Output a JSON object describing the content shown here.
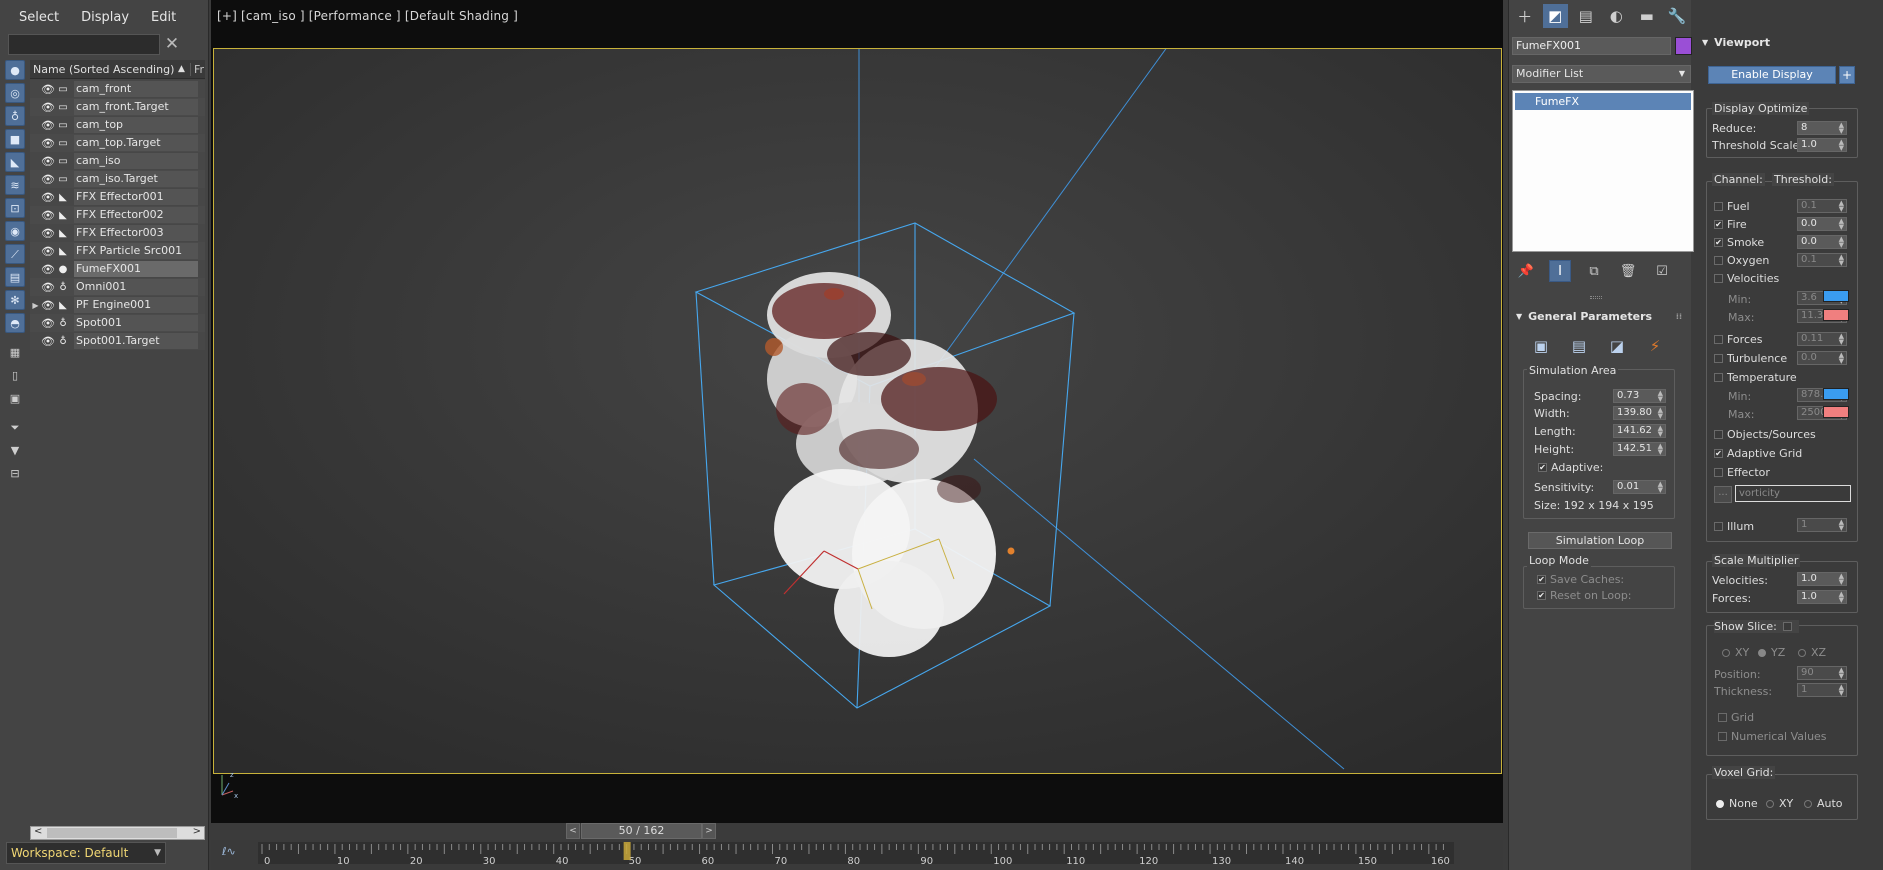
{
  "menu": [
    "Select",
    "Display",
    "Edit"
  ],
  "explorer": {
    "column_name": "Name (Sorted Ascending)",
    "column_frozen": "Fr",
    "sort_glyph": "▲",
    "clear_glyph": "✕",
    "workspace": "Workspace: Default",
    "items": [
      {
        "label": "cam_front",
        "type": "camera",
        "expand": false
      },
      {
        "label": "cam_front.Target",
        "type": "camera",
        "expand": false
      },
      {
        "label": "cam_top",
        "type": "camera",
        "expand": false
      },
      {
        "label": "cam_top.Target",
        "type": "camera",
        "expand": false
      },
      {
        "label": "cam_iso",
        "type": "camera",
        "expand": false
      },
      {
        "label": "cam_iso.Target",
        "type": "camera",
        "expand": false
      },
      {
        "label": "FFX Effector001",
        "type": "helper",
        "expand": false
      },
      {
        "label": "FFX Effector002",
        "type": "helper",
        "expand": false
      },
      {
        "label": "FFX Effector003",
        "type": "helper",
        "expand": false
      },
      {
        "label": "FFX Particle Src001",
        "type": "helper",
        "expand": false
      },
      {
        "label": "FumeFX001",
        "type": "geometry",
        "expand": false
      },
      {
        "label": "Omni001",
        "type": "light",
        "expand": false
      },
      {
        "label": "PF Engine001",
        "type": "helper",
        "expand": true
      },
      {
        "label": "Spot001",
        "type": "light",
        "expand": false
      },
      {
        "label": "Spot001.Target",
        "type": "light",
        "expand": false
      }
    ]
  },
  "viewport": {
    "label": "[+] [cam_iso ] [Performance ] [Default Shading ]",
    "axis_z": "z",
    "axis_x": "x"
  },
  "timeline": {
    "slider_text": "50 / 162",
    "current": 50,
    "end": 162,
    "ticks": [
      0,
      10,
      20,
      30,
      40,
      50,
      60,
      70,
      80,
      90,
      100,
      110,
      120,
      130,
      140,
      150,
      160
    ],
    "prev": "<",
    "next": ">"
  },
  "command_panel": {
    "object_name": "FumeFX001",
    "object_color": "#9a4fd6",
    "modifier_list": "Modifier List",
    "stack_item": "FumeFX",
    "general": {
      "title": "General Parameters",
      "sim_area_title": "Simulation Area",
      "spacing_label": "Spacing:",
      "spacing": "0.73",
      "width_label": "Width:",
      "width": "139.80",
      "length_label": "Length:",
      "length": "141.62",
      "height_label": "Height:",
      "height": "142.51",
      "adaptive_label": "Adaptive:",
      "sensitivity_label": "Sensitivity:",
      "sensitivity": "0.01",
      "size_text": "Size:  192 x 194 x 195",
      "sim_loop": "Simulation Loop",
      "loop_mode_title": "Loop Mode",
      "save_caches": "Save Caches:",
      "reset_on_loop": "Reset on Loop:"
    }
  },
  "viewport_panel": {
    "title": "Viewport",
    "enable_display": "Enable Display",
    "plus": "+",
    "display_optimize_title": "Display Optimize",
    "reduce_label": "Reduce:",
    "reduce": "8",
    "threshold_scale_label": "Threshold Scale:",
    "threshold_scale": "1.0",
    "channel_header": "Channel:",
    "threshold_header": "Threshold:",
    "channels": [
      {
        "label": "Fuel",
        "checked": false,
        "value": "0.1",
        "enabled": false
      },
      {
        "label": "Fire",
        "checked": true,
        "value": "0.0",
        "enabled": true
      },
      {
        "label": "Smoke",
        "checked": true,
        "value": "0.0",
        "enabled": true
      },
      {
        "label": "Oxygen",
        "checked": false,
        "value": "0.1",
        "enabled": false
      },
      {
        "label": "Velocities",
        "checked": false
      }
    ],
    "vel_min_label": "Min:",
    "vel_min": "3.6",
    "vel_max_label": "Max:",
    "vel_max": "11.34",
    "forces_label": "Forces",
    "forces": "0.11",
    "turbulence_label": "Turbulence",
    "turbulence": "0.0",
    "temperature_label": "Temperature",
    "temp_min_label": "Min:",
    "temp_min": "878.0",
    "temp_max_label": "Max:",
    "temp_max": "2500.0",
    "objects_sources": "Objects/Sources",
    "adaptive_grid": "Adaptive Grid",
    "effector": "Effector",
    "effector_dots": "...",
    "effector_value": "vorticity",
    "illum_label": "Illum",
    "illum": "1",
    "scale_mult_title": "Scale Multiplier",
    "sm_vel_label": "Velocities:",
    "sm_vel": "1.0",
    "sm_forces_label": "Forces:",
    "sm_forces": "1.0",
    "show_slice": "Show Slice:",
    "slice_xy": "XY",
    "slice_yz": "YZ",
    "slice_xz": "XZ",
    "position_label": "Position:",
    "position": "90",
    "thickness_label": "Thickness:",
    "thickness": "1",
    "grid_label": "Grid",
    "numerical_values": "Numerical Values",
    "voxel_grid_title": "Voxel Grid:",
    "voxel_none": "None",
    "voxel_xy": "XY",
    "voxel_auto": "Auto",
    "colors": {
      "min_swatch": "#3a9cf0",
      "max_swatch": "#f07f7f"
    }
  }
}
